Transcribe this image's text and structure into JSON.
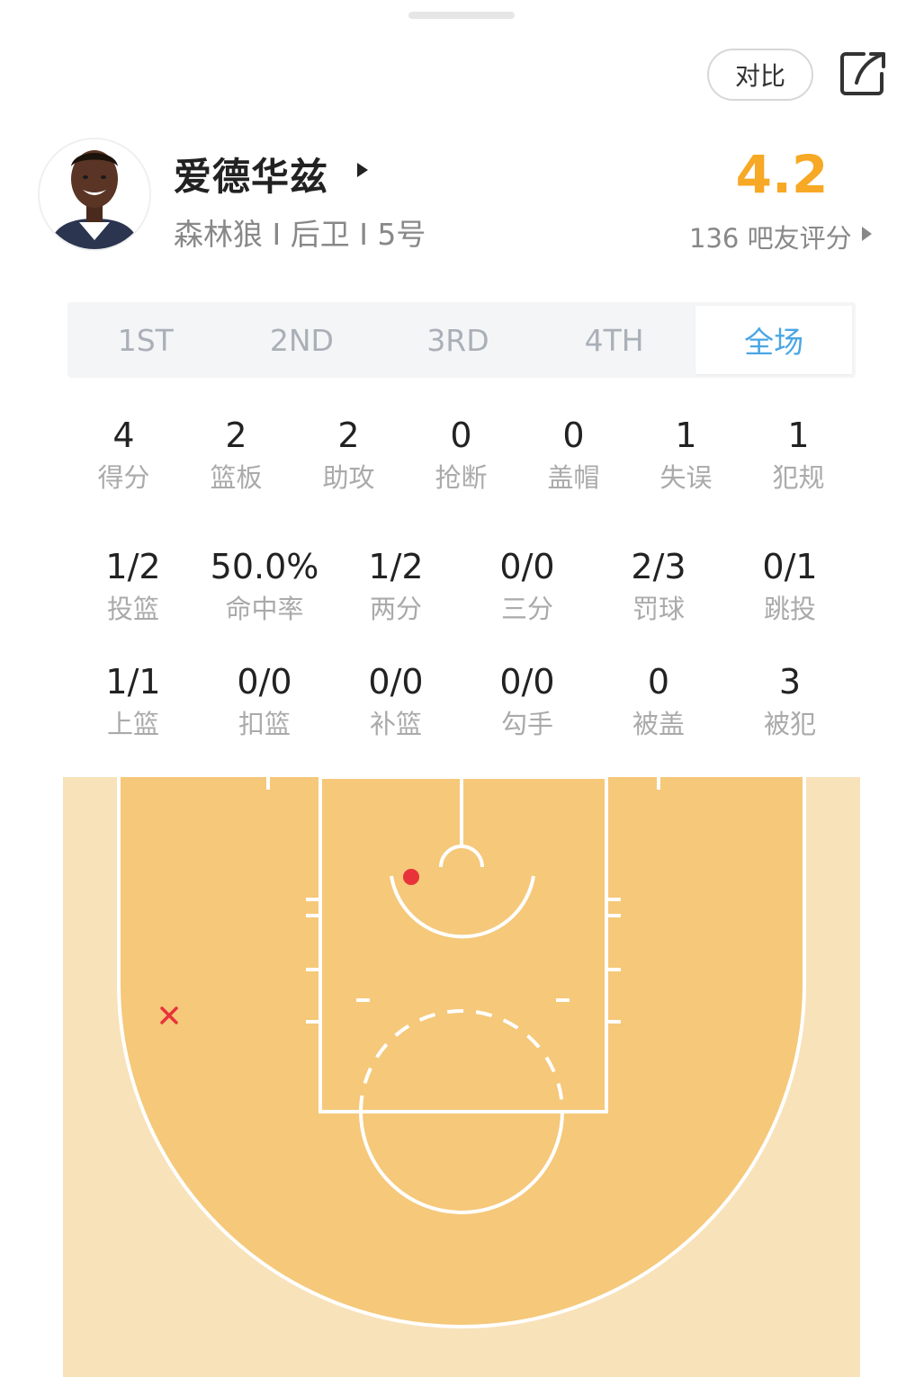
{
  "header": {
    "compare_label": "对比",
    "icons": {
      "share": "share-icon",
      "avatar": "player-avatar"
    }
  },
  "player": {
    "name": "爱德华兹",
    "meta": "森林狼 I 后卫 I 5号"
  },
  "rating": {
    "score": "4.2",
    "votes": "136 吧友评分"
  },
  "tabs": [
    {
      "label": "1ST",
      "active": false
    },
    {
      "label": "2ND",
      "active": false
    },
    {
      "label": "3RD",
      "active": false
    },
    {
      "label": "4TH",
      "active": false
    },
    {
      "label": "全场",
      "active": true
    }
  ],
  "stats_basic": [
    {
      "value": "4",
      "label": "得分"
    },
    {
      "value": "2",
      "label": "篮板"
    },
    {
      "value": "2",
      "label": "助攻"
    },
    {
      "value": "0",
      "label": "抢断"
    },
    {
      "value": "0",
      "label": "盖帽"
    },
    {
      "value": "1",
      "label": "失误"
    },
    {
      "value": "1",
      "label": "犯规"
    }
  ],
  "stats_shooting": [
    {
      "value": "1/2",
      "label": "投篮"
    },
    {
      "value": "50.0%",
      "label": "命中率"
    },
    {
      "value": "1/2",
      "label": "两分"
    },
    {
      "value": "0/0",
      "label": "三分"
    },
    {
      "value": "2/3",
      "label": "罚球"
    },
    {
      "value": "0/1",
      "label": "跳投"
    }
  ],
  "stats_detail": [
    {
      "value": "1/1",
      "label": "上篮"
    },
    {
      "value": "0/0",
      "label": "扣篮"
    },
    {
      "value": "0/0",
      "label": "补篮"
    },
    {
      "value": "0/0",
      "label": "勾手"
    },
    {
      "value": "0",
      "label": "被盖"
    },
    {
      "value": "3",
      "label": "被犯"
    }
  ],
  "shot_chart": {
    "colors": {
      "made": "#e8333a",
      "missed": "#e8333a",
      "court": "#f5c87a",
      "outside": "#f8e2ba"
    },
    "shots": [
      {
        "result": "made",
        "location": "paint, near free-throw circle"
      },
      {
        "result": "missed",
        "location": "left wing, inside the arc"
      }
    ]
  }
}
